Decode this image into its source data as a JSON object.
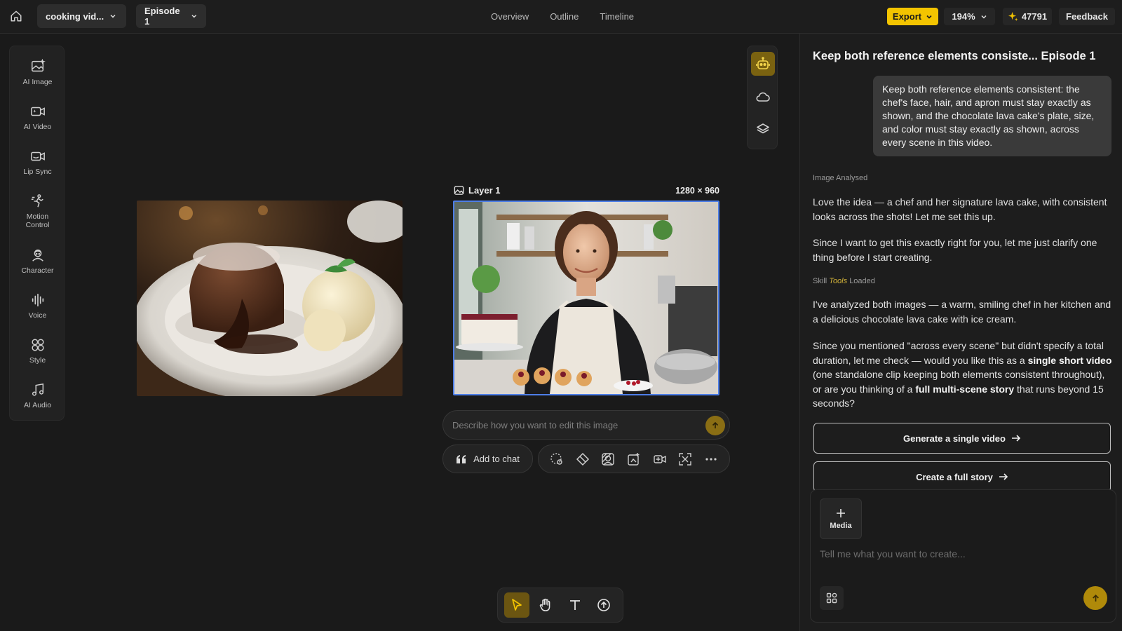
{
  "topbar": {
    "project_name": "cooking vid...",
    "episode": "Episode 1",
    "tabs": [
      "Overview",
      "Outline",
      "Timeline"
    ],
    "export_label": "Export",
    "zoom": "194%",
    "credits": "47791",
    "feedback_label": "Feedback",
    "accent_color": "#f3c400"
  },
  "left_rail": {
    "items": [
      {
        "label": "AI Image",
        "icon": "ai-image-icon"
      },
      {
        "label": "AI Video",
        "icon": "ai-video-icon"
      },
      {
        "label": "Lip Sync",
        "icon": "lip-sync-icon"
      },
      {
        "label": "Motion\nControl",
        "icon": "motion-control-icon"
      },
      {
        "label": "Character",
        "icon": "character-icon"
      },
      {
        "label": "Voice",
        "icon": "voice-icon"
      },
      {
        "label": "Style",
        "icon": "style-icon"
      },
      {
        "label": "AI Audio",
        "icon": "ai-audio-icon"
      }
    ]
  },
  "canvas": {
    "layer_label": "Layer 1",
    "dimensions": "1280 × 960",
    "edit_placeholder": "Describe how you want to edit this image",
    "add_to_chat": "Add to chat"
  },
  "chat": {
    "title": "Keep both reference elements consiste... Episode 1",
    "user_message": "Keep both reference elements consistent: the chef's face, hair, and apron must stay exactly as shown, and the chocolate lava cake's plate, size, and color must stay exactly as shown, across every scene in this video.",
    "meta_image_analysed": "Image Analysed",
    "reply_1": "Love the idea — a chef and her signature lava cake, with consistent looks across the shots! Let me set this up.",
    "reply_2": "Since I want to get this exactly right for you, let me just clarify one thing before I start creating.",
    "meta_skill": "Skill",
    "meta_tools": "Tools",
    "meta_loaded": "Loaded",
    "reply_3": "I've analyzed both images — a warm, smiling chef in her kitchen and a delicious chocolate lava cake with ice cream.",
    "reply_4": {
      "part_a": "Since you mentioned \"across every scene\" but didn't specify a total duration, let me check — would you like this as a ",
      "bold_a": "single short video",
      "part_b": " (one standalone clip keeping both elements consistent throughout), or are you thinking of a ",
      "bold_b": "full multi-scene story",
      "part_c": " that runs beyond 15 seconds?"
    },
    "choice_1": "Generate a single video",
    "choice_2": "Create a full story",
    "media_label": "Media",
    "composer_placeholder": "Tell me what you want to create..."
  }
}
